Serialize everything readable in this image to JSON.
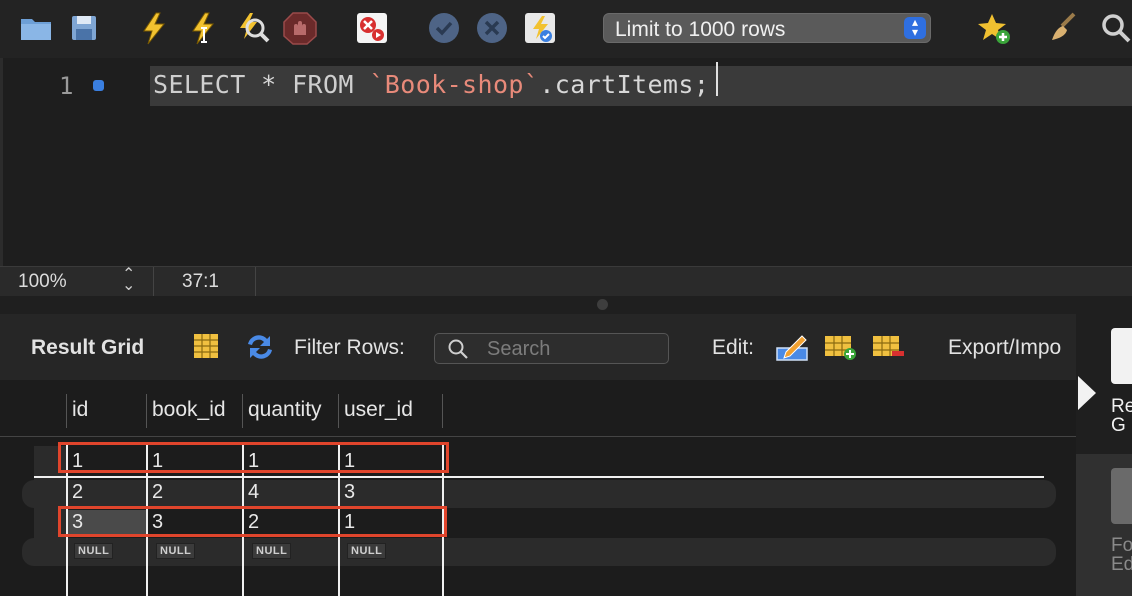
{
  "toolbar": {
    "icons": [
      "open-folder-icon",
      "save-icon",
      "execute-icon",
      "execute-current-icon",
      "explain-icon",
      "stop-icon",
      "toggle-stop-on-error-icon",
      "commit-icon",
      "rollback-icon",
      "autocommit-icon",
      "add-snippet-icon",
      "beautify-icon",
      "find-icon"
    ],
    "limit_label": "Limit to 1000 rows"
  },
  "editor": {
    "line_number": "1",
    "code": {
      "kw1": "SELECT",
      "star": " * ",
      "kw2": "FROM",
      "space": " ",
      "schema": "`Book-shop`",
      "rest": ".cartItems;"
    }
  },
  "status": {
    "zoom": "100%",
    "cursor_position": "37:1"
  },
  "result_toolbar": {
    "title": "Result Grid",
    "filter_label": "Filter Rows:",
    "search_placeholder": "Search",
    "edit_label": "Edit:",
    "export_label": "Export/Impo"
  },
  "side_panel": {
    "tab1_label_line1": "Re",
    "tab1_label_line2": "G",
    "tab2_label_line1": "Fo",
    "tab2_label_line2": "Ed"
  },
  "grid": {
    "columns": [
      "id",
      "book_id",
      "quantity",
      "user_id"
    ],
    "rows": [
      [
        "1",
        "1",
        "1",
        "1"
      ],
      [
        "2",
        "2",
        "4",
        "3"
      ],
      [
        "3",
        "3",
        "2",
        "1"
      ]
    ],
    "null_row": [
      "NULL",
      "NULL",
      "NULL",
      "NULL"
    ]
  },
  "colors": {
    "highlight": "#e0452c",
    "accent": "#2f6fe0",
    "background": "#1c1c1c"
  }
}
